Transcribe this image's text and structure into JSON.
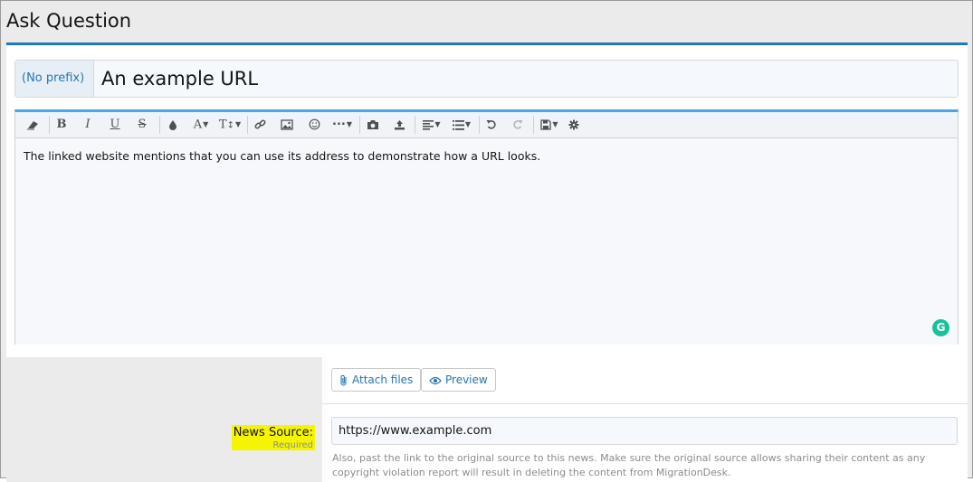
{
  "page": {
    "title": "Ask Question"
  },
  "title_field": {
    "prefix_label": "(No prefix)",
    "value": "An example URL"
  },
  "editor": {
    "toolbar": {
      "font_size_label": "A",
      "text_size_label": "T",
      "items": [
        "remove-format",
        "bold",
        "italic",
        "underline",
        "strikethrough",
        "text-color",
        "font-size",
        "text-size",
        "link",
        "image",
        "smilies",
        "more",
        "screenshot",
        "upload",
        "align",
        "list",
        "undo",
        "redo",
        "drafts",
        "settings"
      ]
    },
    "body_text": "The linked website mentions that you can use its address to demonstrate how a URL looks.",
    "grammarly_label": "G"
  },
  "actions": {
    "attach_label": "Attach files",
    "preview_label": "Preview"
  },
  "news_source": {
    "label": "News Source:",
    "required_label": "Required",
    "value": "https://www.example.com",
    "hint": "Also, past the link to the original source to this news. Make sure the original source allows sharing their content as any copyright violation report will result in deleting the content from MigrationDesk."
  },
  "colors": {
    "accent": "#2577b1",
    "editor_top": "#47a7eb",
    "highlight": "#f5f500",
    "grammarly": "#15c39a"
  }
}
